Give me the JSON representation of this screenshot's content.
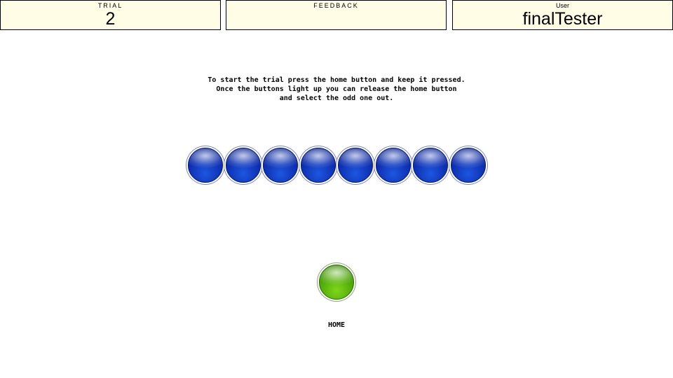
{
  "header": {
    "trial": {
      "label": "TRIAL",
      "value": "2"
    },
    "feedback": {
      "label": "FEEDBACK",
      "value": ""
    },
    "user": {
      "label": "User",
      "value": "finalTester"
    }
  },
  "instructions": {
    "line1": "To start the trial press the home button and keep it pressed.",
    "line2": "Once the buttons light up you can release the home button",
    "line3": "and select the odd one out."
  },
  "choices": {
    "count": 8,
    "color": "#0d2fb0"
  },
  "home": {
    "label": "HOME",
    "color": "#4fa80a"
  }
}
